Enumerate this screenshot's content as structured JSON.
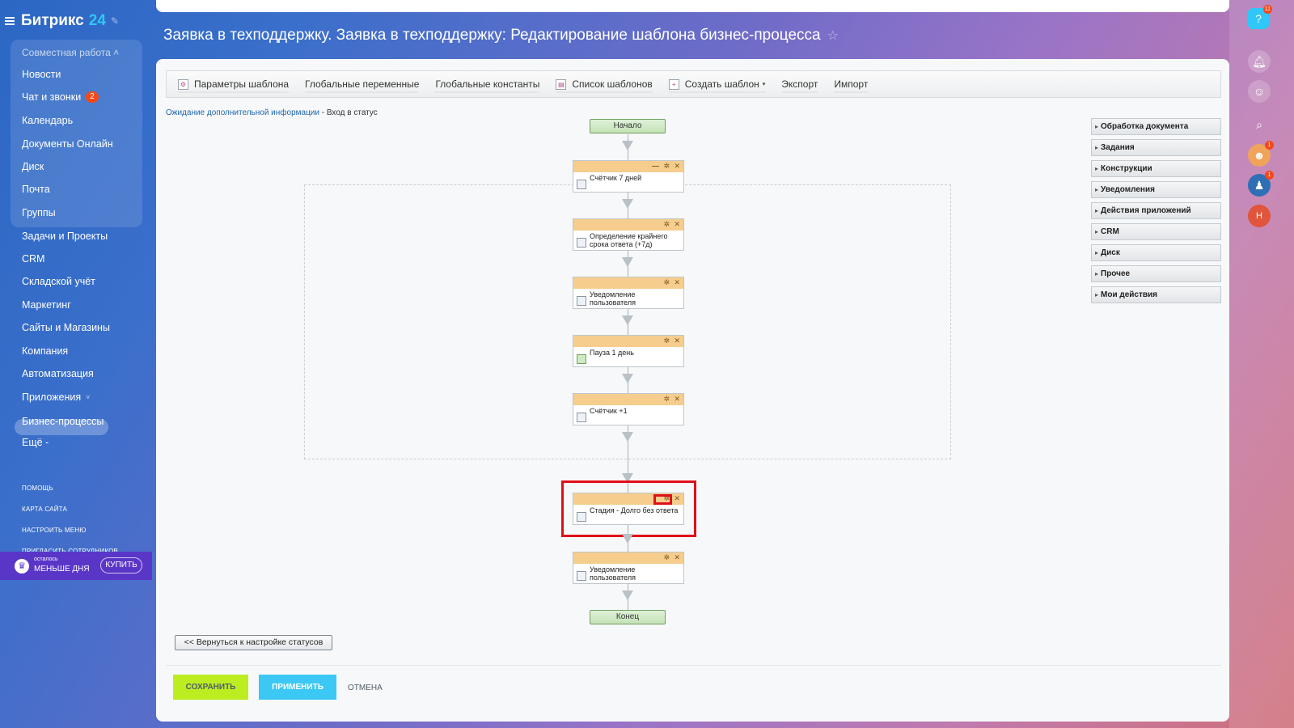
{
  "sidebar": {
    "logo": "Битрикс",
    "logo_num": "24",
    "group_title": "Совместная работа",
    "items": [
      "Новости",
      "Чат и звонки",
      "Календарь",
      "Документы Онлайн",
      "Диск",
      "Почта",
      "Группы",
      "Задачи и Проекты",
      "CRM",
      "Складской учёт",
      "Маркетинг",
      "Сайты и Магазины",
      "Компания",
      "Автоматизация",
      "Приложения",
      "Бизнес-процессы",
      "Ещё -"
    ],
    "chat_badge": "2",
    "small_links": [
      "ПОМОЩЬ",
      "КАРТА САЙТА",
      "НАСТРОИТЬ МЕНЮ",
      "ПРИГЛАСИТЬ СОТРУДНИКОВ"
    ],
    "promo_line1": "осталось",
    "promo_line2": "МЕНЬШЕ ДНЯ",
    "promo_button": "КУПИТЬ"
  },
  "rail": {
    "help_badge": "11",
    "avatar1_badge": "1",
    "avatar2_badge": "1",
    "user_initial": "Н"
  },
  "page": {
    "title": "Заявка в техподдержку. Заявка в техподдержку: Редактирование шаблона бизнес-процесса"
  },
  "toolbar": {
    "items": [
      "Параметры шаблона",
      "Глобальные переменные",
      "Глобальные константы",
      "Список шаблонов",
      "Создать шаблон",
      "Экспорт",
      "Импорт"
    ]
  },
  "breadcrumb": {
    "link": "Ожидание дополнительной информации",
    "separator": " - ",
    "current": "Вход в статус"
  },
  "flow": {
    "start": "Начало",
    "end": "Конец",
    "activities": [
      "Счётчик 7 дней",
      "Определение крайнего срока ответа (+7д)",
      "Уведомление пользователя",
      "Пауза 1 день",
      "Счётчик +1",
      "Стадия - Долго без ответа",
      "Уведомление пользователя"
    ]
  },
  "palette": {
    "groups": [
      "Обработка документа",
      "Задания",
      "Конструкции",
      "Уведомления",
      "Действия приложений",
      "CRM",
      "Диск",
      "Прочее",
      "Мои действия"
    ]
  },
  "footer": {
    "back_button": "<< Вернуться к настройке статусов",
    "save": "СОХРАНИТЬ",
    "apply": "ПРИМЕНИТЬ",
    "cancel": "ОТМЕНА"
  },
  "colors": {
    "save_button": "#bbed21",
    "apply_button": "#3bc8f5",
    "activity_header": "#f6cd8d",
    "highlight": "#e0101a"
  }
}
